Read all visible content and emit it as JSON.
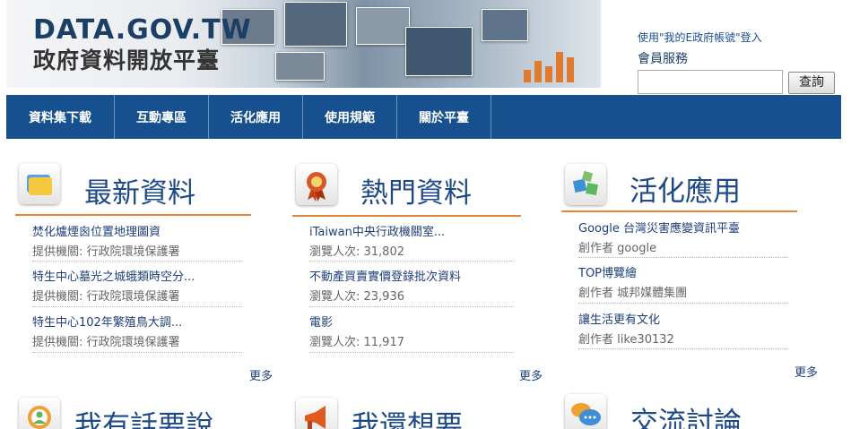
{
  "header": {
    "logo_en": "DATA.GOV.TW",
    "logo_zh": "政府資料開放平臺",
    "login_hint": "使用\"我的E政府帳號\"登入",
    "member_label": "會員服務",
    "search_button": "查詢",
    "search_value": ""
  },
  "nav": [
    "資料集下載",
    "互動專區",
    "活化應用",
    "使用規範",
    "關於平臺"
  ],
  "sections": {
    "latest": {
      "title": "最新資料",
      "items": [
        {
          "title": "焚化爐煙囪位置地理圖資",
          "sub": "提供機關: 行政院環境保護署"
        },
        {
          "title": "特生中心墓光之城蛾類時空分...",
          "sub": "提供機關: 行政院環境保護署"
        },
        {
          "title": "特生中心102年繁殖鳥大調...",
          "sub": "提供機關: 行政院環境保護署"
        }
      ],
      "more": "更多"
    },
    "popular": {
      "title": "熱門資料",
      "items": [
        {
          "title": "iTaiwan中央行政機關室...",
          "sub": "瀏覽人次: 31,802"
        },
        {
          "title": "不動產買賣實價登錄批次資料",
          "sub": "瀏覽人次: 23,936"
        },
        {
          "title": "電影",
          "sub": "瀏覽人次: 11,917"
        }
      ],
      "more": "更多"
    },
    "apps": {
      "title": "活化應用",
      "items": [
        {
          "title": "Google 台灣災害應變資訊平臺",
          "sub": "創作者 google"
        },
        {
          "title": "TOP博覽繪",
          "sub": "創作者 城邦媒體集團"
        },
        {
          "title": "讓生活更有文化",
          "sub": "創作者 like30132"
        }
      ],
      "more": "更多"
    },
    "voice": {
      "title": "我有話要說"
    },
    "wish": {
      "title": "我還想要"
    },
    "forum": {
      "title": "交流討論"
    }
  },
  "colors": {
    "nav": "#17508f",
    "accent_rule": "#e8853c",
    "title": "#1d4a86"
  }
}
